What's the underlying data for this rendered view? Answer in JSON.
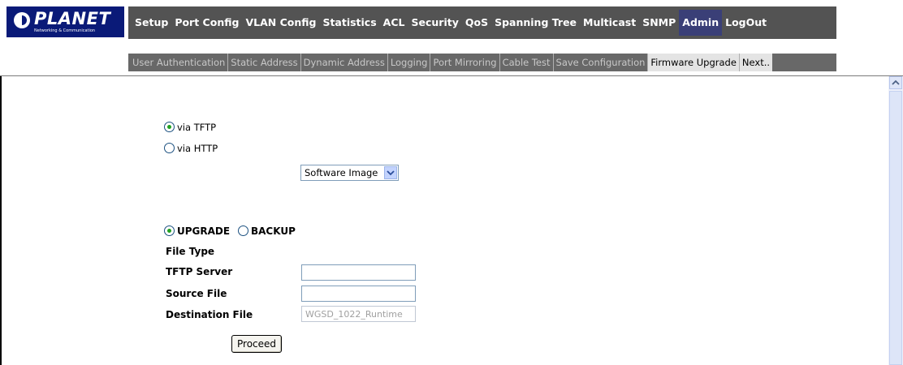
{
  "brand": {
    "name": "PLANET",
    "tagline": "Networking & Communication",
    "logo_color": "#0a1a78"
  },
  "main_nav": {
    "items": [
      {
        "label": "Setup"
      },
      {
        "label": "Port Config"
      },
      {
        "label": "VLAN Config"
      },
      {
        "label": "Statistics"
      },
      {
        "label": "ACL"
      },
      {
        "label": "Security"
      },
      {
        "label": "QoS"
      },
      {
        "label": "Spanning Tree"
      },
      {
        "label": "Multicast"
      },
      {
        "label": "SNMP"
      },
      {
        "label": "Admin",
        "active": true
      },
      {
        "label": "LogOut"
      }
    ]
  },
  "sub_nav": {
    "items": [
      {
        "label": "User Authentication"
      },
      {
        "label": "Static Address"
      },
      {
        "label": "Dynamic Address"
      },
      {
        "label": "Logging"
      },
      {
        "label": "Port Mirroring"
      },
      {
        "label": "Cable Test"
      },
      {
        "label": "Save Configuration"
      },
      {
        "label": "Firmware Upgrade",
        "active": true
      },
      {
        "label": "Next.."
      }
    ]
  },
  "protocol": {
    "tftp_label": "via TFTP",
    "http_label": "via HTTP",
    "selected": "tftp"
  },
  "operation": {
    "upgrade_label": "UPGRADE",
    "backup_label": "BACKUP",
    "selected": "upgrade"
  },
  "form": {
    "file_type_label": "File Type",
    "file_type_value": "Software Image",
    "tftp_server_label": "TFTP Server",
    "tftp_server_value": "",
    "source_file_label": "Source File",
    "source_file_value": "",
    "destination_file_label": "Destination File",
    "destination_file_value": "WGSD_1022_Runtime",
    "proceed_label": "Proceed"
  },
  "colors": {
    "nav_bg": "#535353",
    "nav_active": "#3a3f77",
    "subnav_bg": "#686868",
    "radio_dot": "#21a121"
  },
  "icons": {
    "scroll_up": "chevron-up-icon",
    "select_arrow": "chevron-down-icon"
  }
}
